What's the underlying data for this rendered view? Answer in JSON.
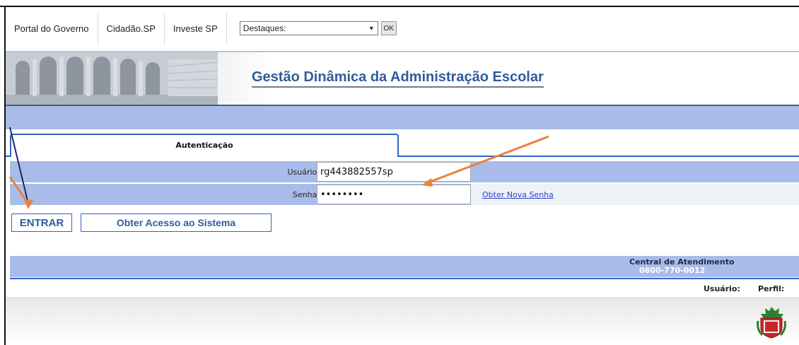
{
  "topnav": {
    "links": [
      "Portal do Governo",
      "Cidadão.SP",
      "Investe SP"
    ],
    "select_value": "Destaques:",
    "ok_label": "OK"
  },
  "banner": {
    "title": "Gestão Dinâmica da Administração Escolar"
  },
  "tab": {
    "label": "Autenticação"
  },
  "form": {
    "user_label": "Usuário:",
    "user_value": "rg443882557sp",
    "password_label": "Senha:",
    "password_value": "••••••••",
    "new_password_link": "Obter Nova Senha"
  },
  "buttons": {
    "entrar": "ENTRAR",
    "obter_acesso": "Obter Acesso ao Sistema"
  },
  "footer": {
    "central_label": "Central de Atendimento",
    "phone": "0800-770-0012",
    "user_label": "Usuário:",
    "perfil_label": "Perfil:"
  },
  "colors": {
    "band": "#a9bce9",
    "accent": "#2f66c0",
    "title": "#2f5d9e",
    "annotation_arrow": "#e8833a"
  }
}
